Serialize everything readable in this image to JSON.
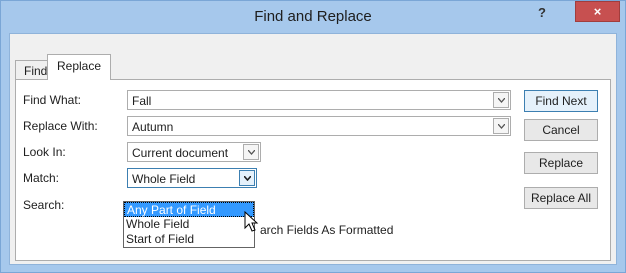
{
  "window": {
    "title": "Find and Replace",
    "help": "?",
    "close": "×"
  },
  "tabs": [
    {
      "label": "Find"
    },
    {
      "label": "Replace"
    }
  ],
  "form": {
    "find_what_label": "Find What:",
    "find_what_value": "Fall",
    "replace_with_label": "Replace With:",
    "replace_with_value": "Autumn",
    "look_in_label": "Look In:",
    "look_in_value": "Current document",
    "match_label": "Match:",
    "match_value": "Whole Field",
    "search_label": "Search:",
    "search_formatted_label": "arch Fields As Formatted"
  },
  "buttons": {
    "find_next": "Find Next",
    "cancel": "Cancel",
    "replace": "Replace",
    "replace_all": "Replace All"
  },
  "match_options": [
    {
      "label": "Any Part of Field",
      "highlighted": true
    },
    {
      "label": "Whole Field",
      "highlighted": false
    },
    {
      "label": "Start of Field",
      "highlighted": false
    }
  ],
  "colors": {
    "close_red": "#c75050",
    "frame_blue": "#a6c8ec",
    "highlight": "#3399ff"
  }
}
